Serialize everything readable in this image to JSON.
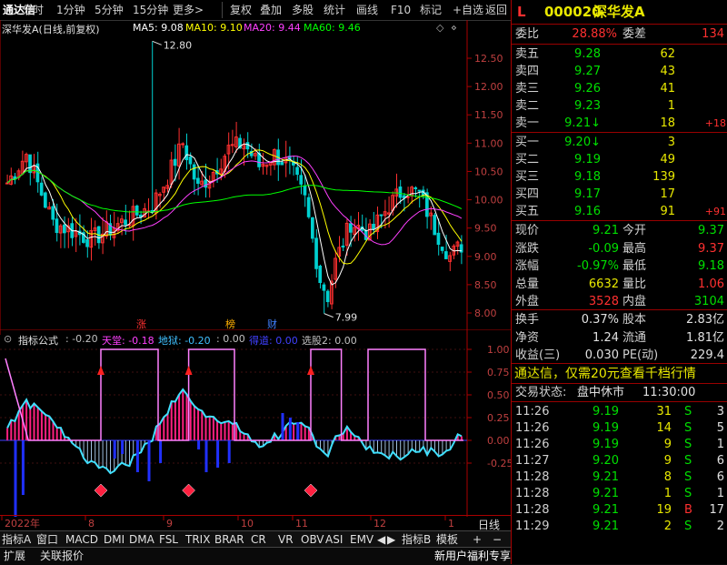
{
  "toolbar": {
    "logo": "通达信",
    "items": [
      "分时",
      "1分钟",
      "5分钟",
      "15分钟",
      "更多>",
      "复权",
      "叠加",
      "多股",
      "统计",
      "画线",
      "F10",
      "标记",
      "+自选",
      "返回"
    ]
  },
  "main_chart": {
    "title": "深华发A(日线,前复权)",
    "ma": [
      {
        "label": "MA5: 9.08",
        "color": "#ffffff"
      },
      {
        "label": "MA10: 9.10",
        "color": "#ffff00"
      },
      {
        "label": "MA20: 9.44",
        "color": "#ff40ff"
      },
      {
        "label": "MA60: 9.46",
        "color": "#00ff00"
      }
    ],
    "y_ticks": [
      "12.50",
      "12.00",
      "11.50",
      "11.00",
      "10.50",
      "10.00",
      "9.50",
      "9.00",
      "8.50",
      "8.00"
    ],
    "high_label": "12.80",
    "low_label": "7.99",
    "markers": [
      "涨",
      "榜",
      "财"
    ]
  },
  "indicator": {
    "name": "指标公式",
    "values": [
      {
        "label": ": -0.20",
        "color": "#c0c0c0"
      },
      {
        "label": "天堂: -0.18",
        "color": "#ff40ff"
      },
      {
        "label": "地狱: -0.20",
        "color": "#40c0ff"
      },
      {
        "label": ": 0.00",
        "color": "#c0c0c0"
      },
      {
        "label": "得道: 0.00",
        "color": "#4040ff"
      },
      {
        "label": "选股2: 0.00",
        "color": "#c0c0c0"
      }
    ],
    "y_ticks": [
      "1.00",
      "0.75",
      "0.50",
      "0.25",
      "0.00",
      "-0.25"
    ]
  },
  "x_axis": {
    "labels": [
      "2022年",
      "8",
      "9",
      "10",
      "11",
      "12",
      "1"
    ],
    "period": "日线"
  },
  "bottom_tabs_1": [
    "指标A",
    "窗口",
    "MACD",
    "DMI",
    "DMA",
    "FSL",
    "TRIX",
    "BRAR",
    "CR",
    "VR",
    "OBV",
    "ASI",
    "EMV",
    "◀",
    "▶",
    "指标B",
    "模板",
    "+",
    "−"
  ],
  "bottom_tabs_2": [
    "扩展",
    "关联报价",
    "新用户福利专享",
    "笔",
    "价",
    "细",
    "势",
    "联",
    "值",
    "主",
    "档",
    "分"
  ],
  "quote": {
    "flag": "L",
    "code": "000020",
    "name": "深华发A",
    "webi_label": "委比",
    "webi": "28.88%",
    "weicha_label": "委差",
    "weicha": "134",
    "asks": [
      {
        "label": "卖五",
        "price": "9.28",
        "vol": "62",
        "chg": ""
      },
      {
        "label": "卖四",
        "price": "9.27",
        "vol": "43",
        "chg": ""
      },
      {
        "label": "卖三",
        "price": "9.26",
        "vol": "41",
        "chg": ""
      },
      {
        "label": "卖二",
        "price": "9.23",
        "vol": "1",
        "chg": ""
      },
      {
        "label": "卖一",
        "price": "9.21↓",
        "vol": "18",
        "chg": "+18"
      }
    ],
    "bids": [
      {
        "label": "买一",
        "price": "9.20↓",
        "vol": "3",
        "chg": ""
      },
      {
        "label": "买二",
        "price": "9.19",
        "vol": "49",
        "chg": ""
      },
      {
        "label": "买三",
        "price": "9.18",
        "vol": "139",
        "chg": ""
      },
      {
        "label": "买四",
        "price": "9.17",
        "vol": "17",
        "chg": ""
      },
      {
        "label": "买五",
        "price": "9.16",
        "vol": "91",
        "chg": "+91"
      }
    ],
    "stats": [
      {
        "l1": "现价",
        "v1": "9.21",
        "l2": "今开",
        "v2": "9.37"
      },
      {
        "l1": "涨跌",
        "v1": "-0.09",
        "l2": "最高",
        "v2": "9.37"
      },
      {
        "l1": "涨幅",
        "v1": "-0.97%",
        "l2": "最低",
        "v2": "9.18"
      },
      {
        "l1": "总量",
        "v1": "6632",
        "l2": "量比",
        "v2": "1.06"
      },
      {
        "l1": "外盘",
        "v1": "3528",
        "l2": "内盘",
        "v2": "3104"
      }
    ],
    "stats2": [
      {
        "l1": "换手",
        "v1": "0.37%",
        "l2": "股本",
        "v2": "2.83亿"
      },
      {
        "l1": "净资",
        "v1": "1.24",
        "l2": "流通",
        "v2": "1.81亿"
      },
      {
        "l1": "收益(三)",
        "v1": "0.030",
        "l2": "PE(动)",
        "v2": "229.4"
      }
    ],
    "ad": "通达信，仅需20元查看千档行情",
    "trade_status_label": "交易状态:",
    "trade_status": "盘中休市",
    "trade_time": "11:30:00",
    "ticks": [
      {
        "time": "11:26",
        "price": "9.19",
        "vol": "31",
        "bs": "S",
        "n": "3"
      },
      {
        "time": "11:26",
        "price": "9.19",
        "vol": "14",
        "bs": "S",
        "n": "5"
      },
      {
        "time": "11:26",
        "price": "9.19",
        "vol": "9",
        "bs": "S",
        "n": "1"
      },
      {
        "time": "11:27",
        "price": "9.20",
        "vol": "9",
        "bs": "S",
        "n": "6"
      },
      {
        "time": "11:28",
        "price": "9.21",
        "vol": "8",
        "bs": "S",
        "n": "6"
      },
      {
        "time": "11:28",
        "price": "9.21",
        "vol": "1",
        "bs": "S",
        "n": "1"
      },
      {
        "time": "11:28",
        "price": "9.21",
        "vol": "19",
        "bs": "B",
        "n": "17"
      },
      {
        "time": "11:29",
        "price": "9.21",
        "vol": "2",
        "bs": "S",
        "n": "2"
      }
    ]
  }
}
